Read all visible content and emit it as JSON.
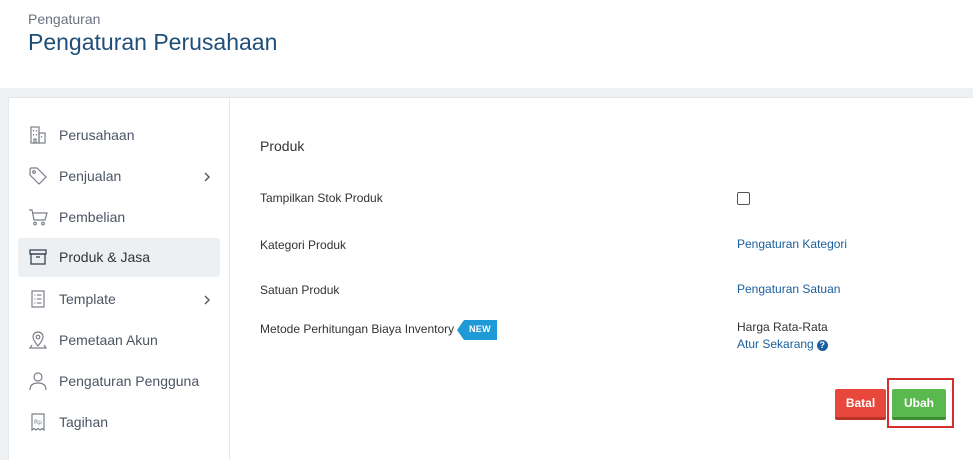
{
  "header": {
    "breadcrumb": "Pengaturan",
    "title": "Pengaturan Perusahaan"
  },
  "sidebar": {
    "items": [
      {
        "label": "Perusahaan",
        "icon": "building-icon",
        "active": false,
        "has_children": false
      },
      {
        "label": "Penjualan",
        "icon": "tag-icon",
        "active": false,
        "has_children": true
      },
      {
        "label": "Pembelian",
        "icon": "cart-icon",
        "active": false,
        "has_children": false
      },
      {
        "label": "Produk & Jasa",
        "icon": "box-icon",
        "active": true,
        "has_children": false
      },
      {
        "label": "Template",
        "icon": "document-icon",
        "active": false,
        "has_children": true
      },
      {
        "label": "Pemetaan Akun",
        "icon": "map-pin-icon",
        "active": false,
        "has_children": false
      },
      {
        "label": "Pengaturan Pengguna",
        "icon": "user-icon",
        "active": false,
        "has_children": false
      },
      {
        "label": "Tagihan",
        "icon": "receipt-icon",
        "active": false,
        "has_children": false
      }
    ]
  },
  "content": {
    "section_title": "Produk",
    "rows": [
      {
        "label": "Tampilkan Stok Produk",
        "control": "checkbox",
        "checked": false
      },
      {
        "label": "Kategori Produk",
        "link": "Pengaturan Kategori"
      },
      {
        "label": "Satuan Produk",
        "link": "Pengaturan Satuan"
      },
      {
        "label": "Metode Perhitungan Biaya Inventory",
        "badge": "NEW",
        "value": "Harga Rata-Rata",
        "link": "Atur Sekarang",
        "help_icon": "question-circle-icon"
      }
    ]
  },
  "actions": {
    "cancel_label": "Batal",
    "save_label": "Ubah"
  },
  "colors": {
    "title": "#1f4e79",
    "link": "#1a5f9e",
    "badge": "#1e9ad6",
    "cancel": "#e8473b",
    "save": "#5ab94e",
    "highlight": "#d32f2f"
  }
}
